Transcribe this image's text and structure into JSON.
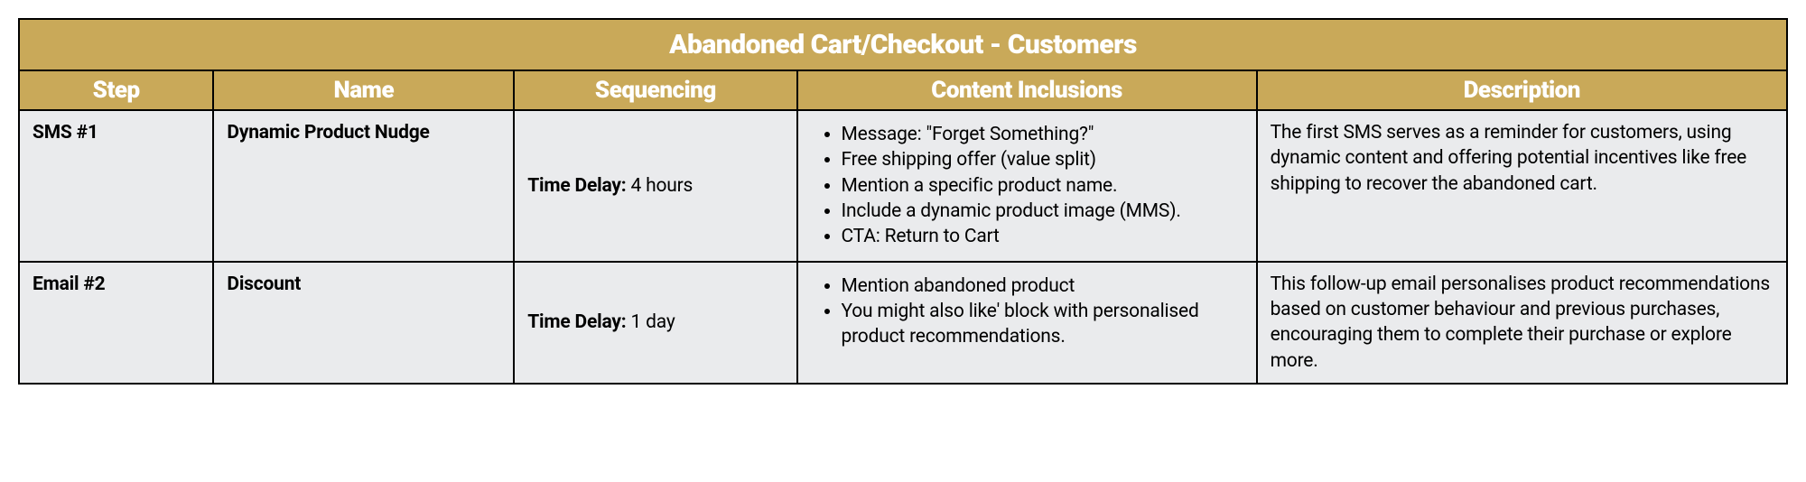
{
  "table": {
    "title": "Abandoned Cart/Checkout - Customers",
    "columns": {
      "step": "Step",
      "name": "Name",
      "sequencing": "Sequencing",
      "content": "Content Inclusions",
      "description": "Description"
    },
    "rows": [
      {
        "step": "SMS #1",
        "name": "Dynamic Product Nudge",
        "sequencing_label": "Time Delay:",
        "sequencing_value": "4 hours",
        "content": [
          "Message: \"Forget Something?\"",
          "Free shipping offer (value split)",
          "Mention a specific product name.",
          "Include a dynamic product image (MMS).",
          "CTA: Return to Cart"
        ],
        "description": "The first SMS serves as a reminder for customers, using dynamic content and offering potential incentives like free shipping to recover the abandoned cart."
      },
      {
        "step": "Email #2",
        "name": "Discount",
        "sequencing_label": "Time Delay:",
        "sequencing_value": "1 day",
        "content": [
          "Mention abandoned product",
          "You might also like' block with personalised product recommendations."
        ],
        "description": "This follow-up email personalises product recommendations based on customer behaviour and previous purchases, encouraging them to complete their purchase or explore more."
      }
    ]
  }
}
